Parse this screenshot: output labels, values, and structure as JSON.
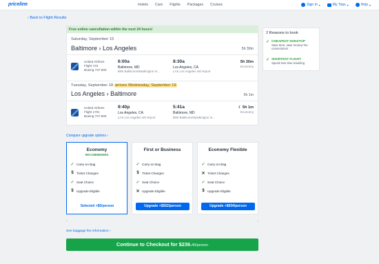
{
  "brand": {
    "logo": "priceline",
    "accent": "#0068ef",
    "green": "#16a34a"
  },
  "nav": {
    "items": [
      "Hotels",
      "Cars",
      "Flights",
      "Packages",
      "Cruises"
    ]
  },
  "account": {
    "sign_in": "Sign In",
    "my_trips": "My Trips",
    "help": "Help"
  },
  "back_link": "‹ Back to Flight Results",
  "itinerary": {
    "banner": "Free online cancellation within the next 24 hours!",
    "outbound": {
      "date": "Saturday, September 15",
      "origin": "Baltimore",
      "destination": "Los Angeles",
      "duration": "5h 30m",
      "airline": "United Airlines",
      "flight": "Flight 723",
      "aircraft": "Boeing 737-800",
      "depart_time": "6:00a",
      "depart_city": "Baltimore, MD",
      "depart_airport": "BWI Baltimore/Washington In...",
      "arrive_time": "8:30a",
      "arrive_city": "Los Angeles, CA",
      "arrive_airport": "LAX Los Angeles Intl Airport",
      "flight_duration": "5h 30m",
      "cabin": "Economy"
    },
    "return": {
      "date": "Tuesday, September 18",
      "arrives_note": "arrives Wednesday, September 19",
      "origin": "Los Angeles",
      "destination": "Baltimore",
      "duration": "5h 1m",
      "airline": "United Airlines",
      "flight": "Flight 1701",
      "aircraft": "Boeing 737-900",
      "depart_time": "9:40p",
      "depart_city": "Los Angeles, CA",
      "depart_airport": "LAX Los Angeles Intl Airport",
      "arrive_time": "5:41a",
      "arrive_city": "Baltimore, MD",
      "arrive_airport": "BWI Baltimore/Washington In...",
      "flight_duration": "5h 1m",
      "cabin": "Economy"
    }
  },
  "reasons": {
    "title": "2 Reasons to book",
    "items": [
      {
        "title": "CHEAPEST NONSTOP",
        "desc": "Save time, save money! No connections!"
      },
      {
        "title": "SHORTEST FLIGHT",
        "desc": "Spend less time traveling"
      }
    ]
  },
  "compare_link": "Compare upgrade options",
  "fares": [
    {
      "name": "Economy",
      "badge": "RECOMMENDED",
      "features": [
        {
          "icon": "check",
          "label": "Carry-on Bag"
        },
        {
          "icon": "dollar",
          "label": "Ticket Changes"
        },
        {
          "icon": "check",
          "label": "Seat Choice"
        },
        {
          "icon": "dollar",
          "label": "Upgrade Eligible"
        }
      ],
      "button": "Selected +$0/person"
    },
    {
      "name": "First or Business",
      "badge": "",
      "features": [
        {
          "icon": "check",
          "label": "Carry-on Bag"
        },
        {
          "icon": "dollar",
          "label": "Ticket Changes"
        },
        {
          "icon": "check",
          "label": "Seat Choice"
        },
        {
          "icon": "cross",
          "label": "Upgrade Eligible"
        }
      ],
      "button": "Upgrade +$552/person"
    },
    {
      "name": "Economy Flexible",
      "badge": "",
      "features": [
        {
          "icon": "check",
          "label": "Carry-on Bag"
        },
        {
          "icon": "cross",
          "label": "Ticket Changes"
        },
        {
          "icon": "check",
          "label": "Seat Choice"
        },
        {
          "icon": "dollar",
          "label": "Upgrade Eligible"
        }
      ],
      "button": "Upgrade +$934/person"
    }
  ],
  "baggage_link": "See baggage fee information",
  "checkout": {
    "label": "Continue to Checkout for $236.",
    "cents": "40",
    "per": "/person"
  }
}
